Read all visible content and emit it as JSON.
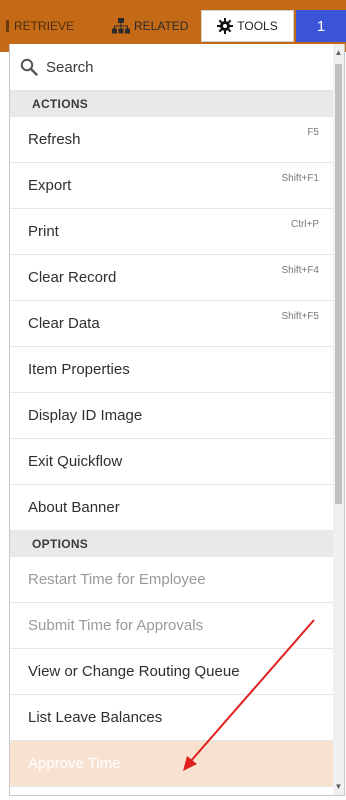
{
  "topbar": {
    "tabs": {
      "retrieve": "RETRIEVE",
      "related": "RELATED",
      "tools": "TOOLS",
      "count": "1"
    },
    "colors": {
      "bar": "#c46a17",
      "count_bg": "#3c55d8"
    }
  },
  "search": {
    "label": "Search"
  },
  "sections": {
    "actions": "ACTIONS",
    "options": "OPTIONS"
  },
  "actions": [
    {
      "label": "Refresh",
      "shortcut": "F5"
    },
    {
      "label": "Export",
      "shortcut": "Shift+F1"
    },
    {
      "label": "Print",
      "shortcut": "Ctrl+P"
    },
    {
      "label": "Clear Record",
      "shortcut": "Shift+F4"
    },
    {
      "label": "Clear Data",
      "shortcut": "Shift+F5"
    },
    {
      "label": "Item Properties",
      "shortcut": ""
    },
    {
      "label": "Display ID Image",
      "shortcut": ""
    },
    {
      "label": "Exit Quickflow",
      "shortcut": ""
    },
    {
      "label": "About Banner",
      "shortcut": ""
    }
  ],
  "options": [
    {
      "label": "Restart Time for Employee",
      "state": "disabled"
    },
    {
      "label": "Submit Time for Approvals",
      "state": "disabled"
    },
    {
      "label": "View or Change Routing Queue",
      "state": "enabled"
    },
    {
      "label": "List Leave Balances",
      "state": "enabled"
    },
    {
      "label": "Approve Time",
      "state": "highlighted"
    }
  ],
  "icons": {
    "retrieve": "grip-icon",
    "related": "hierarchy-icon",
    "tools": "gear-icon",
    "search": "search-icon"
  },
  "annotation": {
    "color": "#e02020"
  }
}
